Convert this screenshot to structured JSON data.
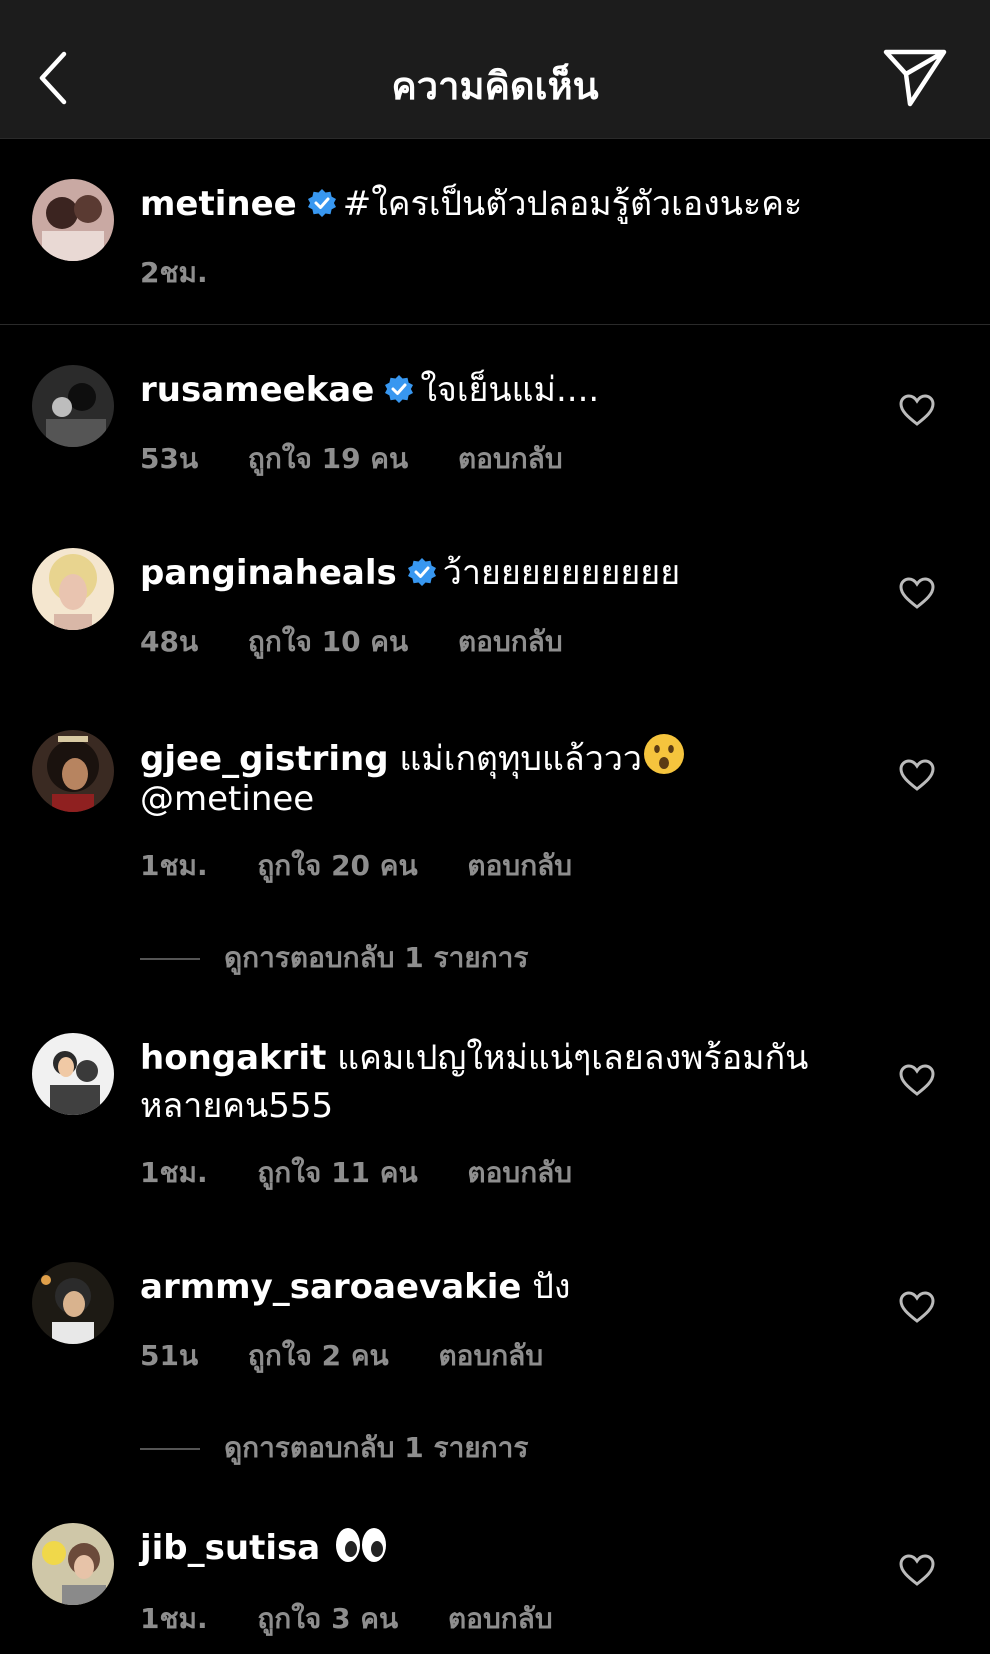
{
  "header": {
    "title": "ความคิดเห็น"
  },
  "caption": {
    "username": "metinee",
    "text": "#ใครเป็นตัวปลอมรู้ตัวเองนะคะ",
    "time": "2ชม."
  },
  "comments": [
    {
      "username": "rusameekae",
      "verified": true,
      "text": "ใจเย็นแม่....",
      "time": "53น",
      "likes": "ถูกใจ 19 คน",
      "reply": "ตอบกลับ"
    },
    {
      "username": "panginaheals",
      "verified": true,
      "text": "ว้ายยยยยยยยยย",
      "time": "48น",
      "likes": "ถูกใจ 10 คน",
      "reply": "ตอบกลับ"
    },
    {
      "username": "gjee_gistring",
      "verified": false,
      "text": "แม่เกตุทุบแล้ววว",
      "text2": "@metinee",
      "emoji": "hushed-face-emoji",
      "time": "1ชม.",
      "likes": "ถูกใจ 20 คน",
      "reply": "ตอบกลับ",
      "view_replies": "ดูการตอบกลับ 1 รายการ"
    },
    {
      "username": "hongakrit",
      "verified": false,
      "text": "แคมเปญใหม่แน่ๆเลยลงพร้อมกัน",
      "text2": "หลายคน555",
      "time": "1ชม.",
      "likes": "ถูกใจ 11 คน",
      "reply": "ตอบกลับ"
    },
    {
      "username": "armmy_saroaevakie",
      "verified": false,
      "text": "ปัง",
      "time": "51น",
      "likes": "ถูกใจ 2 คน",
      "reply": "ตอบกลับ",
      "view_replies": "ดูการตอบกลับ 1 รายการ"
    },
    {
      "username": "jib_sutisa",
      "verified": false,
      "text": "",
      "emoji": "eyes-emoji",
      "time": "1ชม.",
      "likes": "ถูกใจ 3 คน",
      "reply": "ตอบกลับ"
    }
  ],
  "colors": {
    "verified": "#3897f0",
    "muted": "#8e8e8e",
    "header_bg": "#1c1c1c"
  }
}
